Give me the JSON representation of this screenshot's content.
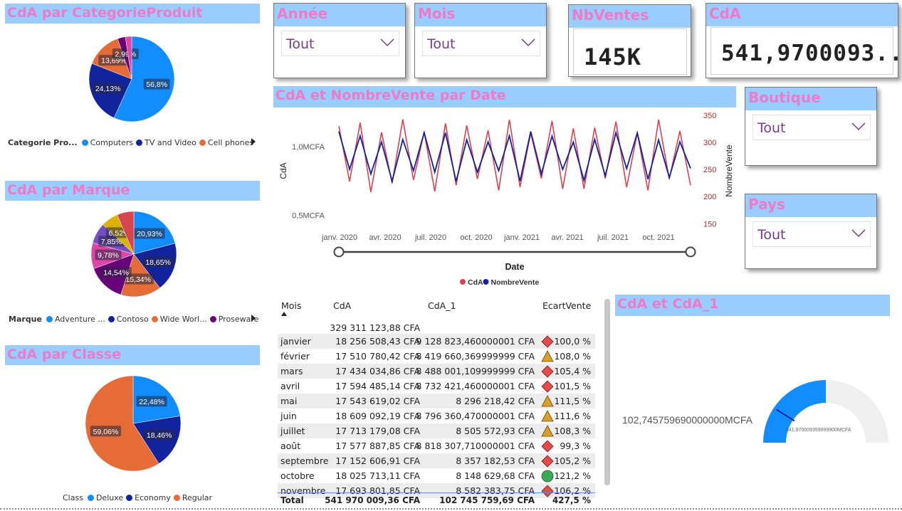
{
  "colors": {
    "band": "#99ccff",
    "title": "#f07ac6",
    "computers": "#118dff",
    "tv_video": "#12239e",
    "cell_phones": "#e66c37",
    "proseware": "#6b007b",
    "cda_line": "#d9434f",
    "nv_line": "#12239e"
  },
  "pie_categorie": {
    "title": "CdA par CategorieProduit",
    "slices": [
      {
        "name": "Computers",
        "value": 56.8,
        "label": "56,8%",
        "color": "#118dff"
      },
      {
        "name": "TV and Video",
        "value": 24.13,
        "label": "24,13%",
        "color": "#12239e"
      },
      {
        "name": "Cell phones",
        "value": 13.69,
        "label": "13,69%",
        "color": "#e66c37"
      },
      {
        "name": "",
        "value": 2.99,
        "label": "2,99%",
        "color": "#6b007b"
      },
      {
        "name": "",
        "value": 2.39,
        "label": "",
        "color": "#e044a7"
      }
    ],
    "legend_title": "Categorie Pro...",
    "legend": [
      {
        "label": "Computers",
        "color": "#118dff"
      },
      {
        "label": "TV and Video",
        "color": "#12239e"
      },
      {
        "label": "Cell phones",
        "color": "#e66c37"
      }
    ]
  },
  "pie_marque": {
    "title": "CdA par Marque",
    "slices": [
      {
        "value": 20.93,
        "label": "20,93%",
        "color": "#118dff"
      },
      {
        "value": 18.65,
        "label": "18,65%",
        "color": "#12239e"
      },
      {
        "value": 15.34,
        "label": "15,34%",
        "color": "#e66c37"
      },
      {
        "value": 14.54,
        "label": "14,54%",
        "color": "#6b007b"
      },
      {
        "value": 9.78,
        "label": "9,78%",
        "color": "#e044a7"
      },
      {
        "value": 7.85,
        "label": "7,85%",
        "color": "#744ec2"
      },
      {
        "value": 6.52,
        "label": "6,52%",
        "color": "#d9b300"
      },
      {
        "value": 6.39,
        "label": "",
        "color": "#d64550"
      }
    ],
    "legend_title": "Marque",
    "legend": [
      {
        "label": "Adventure ...",
        "color": "#118dff"
      },
      {
        "label": "Contoso",
        "color": "#12239e"
      },
      {
        "label": "Wide Worl...",
        "color": "#e66c37"
      },
      {
        "label": "Proseware",
        "color": "#6b007b"
      }
    ]
  },
  "pie_classe": {
    "title": "CdA par Classe",
    "slices": [
      {
        "value": 22.48,
        "label": "22,48%",
        "color": "#118dff"
      },
      {
        "value": 18.46,
        "label": "18,46%",
        "color": "#12239e"
      },
      {
        "value": 59.06,
        "label": "59,06%",
        "color": "#e66c37"
      }
    ],
    "legend_title": "Class",
    "legend": [
      {
        "label": "Deluxe",
        "color": "#118dff"
      },
      {
        "label": "Economy",
        "color": "#12239e"
      },
      {
        "label": "Regular",
        "color": "#e66c37"
      }
    ]
  },
  "slicers": {
    "annee": {
      "title": "Année",
      "value": "Tout"
    },
    "mois": {
      "title": "Mois",
      "value": "Tout"
    },
    "boutique": {
      "title": "Boutique",
      "value": "Tout"
    },
    "pays": {
      "title": "Pays",
      "value": "Tout"
    }
  },
  "kpi": {
    "nbventes": {
      "title": "NbVentes",
      "value": "145K"
    },
    "cda": {
      "title": "CdA",
      "value": "541,9700093..."
    }
  },
  "line_chart": {
    "title": "CdA et NombreVente par Date",
    "y_left_label": "CdA",
    "y_left_ticks": [
      "1,0MCFA",
      "0,5MCFA"
    ],
    "y_right_label": "NombreVente",
    "y_right_ticks": [
      "350",
      "300",
      "250",
      "200",
      "150"
    ],
    "x_ticks": [
      "janv. 2020",
      "avr. 2020",
      "juil. 2020",
      "oct. 2020",
      "janv. 2021",
      "avr. 2021",
      "juil. 2021",
      "oct. 2021"
    ],
    "x_label": "Date",
    "legend": [
      {
        "label": "CdA",
        "color": "#d9434f"
      },
      {
        "label": "NombreVente",
        "color": "#12239e"
      }
    ]
  },
  "chart_data": {
    "type": "line",
    "title": "CdA et NombreVente par Date",
    "xlabel": "Date",
    "ylabel": "CdA",
    "y2label": "NombreVente",
    "x": [
      "janv. 2020",
      "avr. 2020",
      "juil. 2020",
      "oct. 2020",
      "janv. 2021",
      "avr. 2021",
      "juil. 2021",
      "oct. 2021"
    ],
    "ylim": [
      0.4,
      1.25
    ],
    "y2lim": [
      140,
      355
    ],
    "series": [
      {
        "name": "CdA",
        "values": [
          0.95,
          0.75,
          1.1,
          0.8,
          1.05,
          0.7,
          0.95,
          1.0
        ]
      },
      {
        "name": "NombreVente",
        "values": [
          255,
          270,
          300,
          280,
          290,
          250,
          270,
          260
        ]
      }
    ]
  },
  "table": {
    "headers": {
      "mois": "Mois",
      "cda": "CdA",
      "cda1": "CdA_1",
      "ecart": "EcartVente"
    },
    "first": {
      "cda": "329 311 123,88 CFA"
    },
    "rows": [
      {
        "mois": "janvier",
        "cda": "18 256 508,43 CFA",
        "cda1": "9 128 823,460000001 CFA",
        "ecart": "100,0 %",
        "ind": "diamond"
      },
      {
        "mois": "février",
        "cda": "17 510 780,42 CFA",
        "cda1": "8 419 660,369999999 CFA",
        "ecart": "108,0 %",
        "ind": "triangle"
      },
      {
        "mois": "mars",
        "cda": "17 434 034,86 CFA",
        "cda1": "8 488 001,109999999 CFA",
        "ecart": "105,4 %",
        "ind": "diamond"
      },
      {
        "mois": "avril",
        "cda": "17 594 485,14 CFA",
        "cda1": "8 732 421,460000001 CFA",
        "ecart": "101,5 %",
        "ind": "diamond"
      },
      {
        "mois": "mai",
        "cda": "17 543 619,02 CFA",
        "cda1": "8 296 218,42 CFA",
        "ecart": "111,5 %",
        "ind": "triangle"
      },
      {
        "mois": "juin",
        "cda": "18 609 092,19 CFA",
        "cda1": "8 796 360,470000001 CFA",
        "ecart": "111,6 %",
        "ind": "triangle"
      },
      {
        "mois": "juillet",
        "cda": "17 713 179,08 CFA",
        "cda1": "8 505 572,93 CFA",
        "ecart": "108,3 %",
        "ind": "triangle"
      },
      {
        "mois": "août",
        "cda": "17 577 887,85 CFA",
        "cda1": "8 818 307,710000001 CFA",
        "ecart": "99,3 %",
        "ind": "diamond"
      },
      {
        "mois": "septembre",
        "cda": "17 152 606,91 CFA",
        "cda1": "8 357 182,53 CFA",
        "ecart": "105,2 %",
        "ind": "diamond"
      },
      {
        "mois": "octobre",
        "cda": "18 025 713,11 CFA",
        "cda1": "8 148 629,68 CFA",
        "ecart": "121,2 %",
        "ind": "circle"
      },
      {
        "mois": "novembre",
        "cda": "17 693 801,85 CFA",
        "cda1": "8 582 383,75 CFA",
        "ecart": "106,2 %",
        "ind": "diamond"
      }
    ],
    "total": {
      "mois": "Total",
      "cda": "541 970 009,36 CFA",
      "cda1": "102 745 759,69 CFA",
      "ecart": "427,5 %"
    }
  },
  "gauge": {
    "title": "CdA et CdA_1",
    "value_label": "102,745759690000000MCFA",
    "target_label": "541,970009359999900MCFA",
    "fill_fraction": 0.19
  }
}
